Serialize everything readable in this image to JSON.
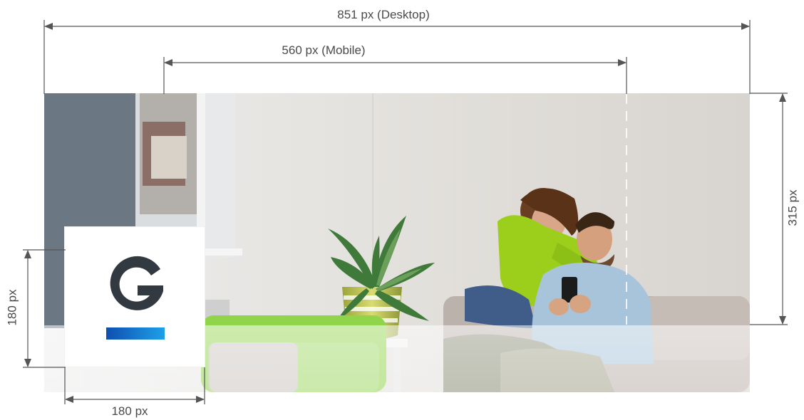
{
  "diagram": {
    "dimensions": {
      "desktop_width_label": "851 px (Desktop)",
      "mobile_width_label": "560 px (Mobile)",
      "height_label": "315 px",
      "profile_height_label": "180 px",
      "profile_width_label": "180 px"
    },
    "logo": {
      "letter": "G",
      "letter_color": "#333940",
      "bar_gradient": [
        "#0d4fb0",
        "#1fa0e8"
      ]
    },
    "colors": {
      "dimension_line": "#555555",
      "guide_dash": "#ffffff",
      "overlay_band": "#d8dadd"
    }
  }
}
